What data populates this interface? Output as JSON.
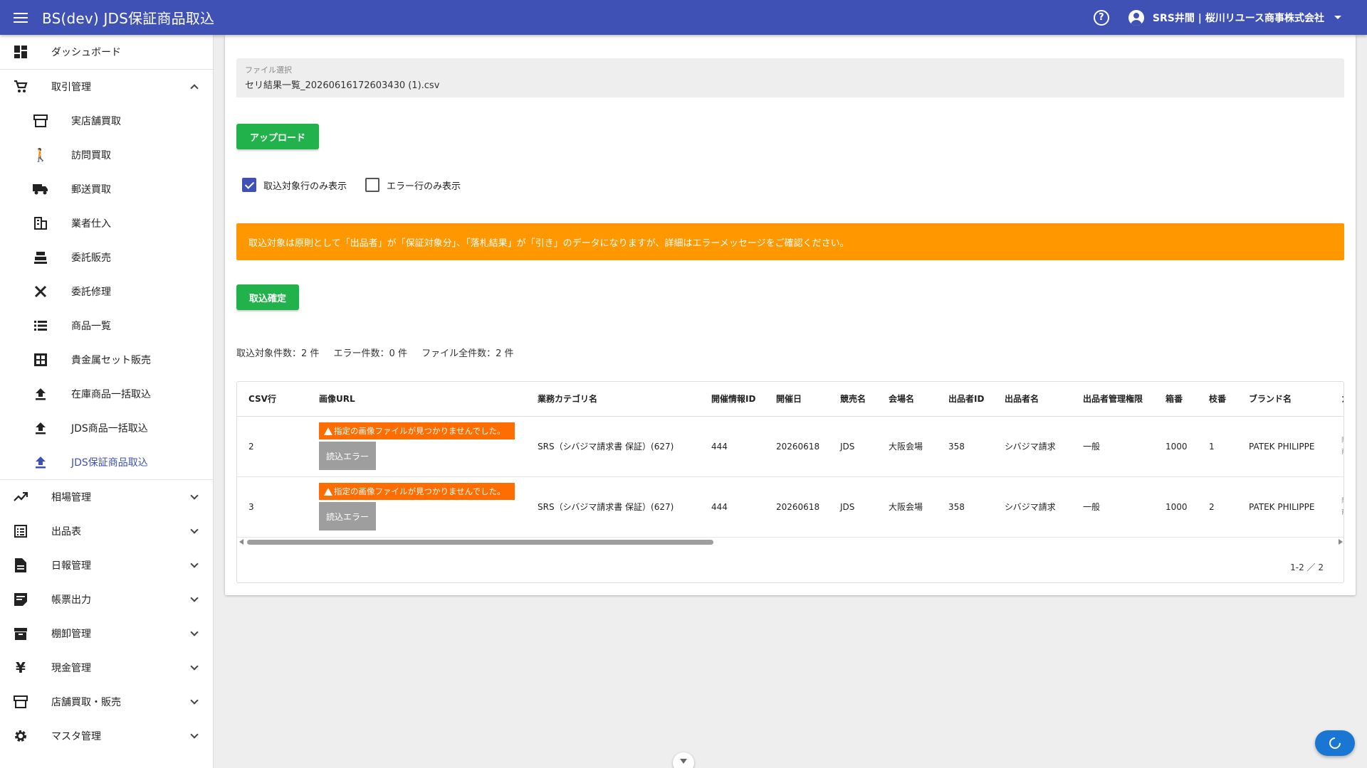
{
  "appbar": {
    "title": "BS(dev) JDS保証商品取込",
    "user": "SRS井間 | 桜川リユース商事株式会社"
  },
  "sidebar": {
    "items": [
      {
        "label": "ダッシュボード"
      },
      {
        "label": "取引管理"
      },
      {
        "label": "実店舗買取"
      },
      {
        "label": "訪問買取"
      },
      {
        "label": "郵送買取"
      },
      {
        "label": "業者仕入"
      },
      {
        "label": "委託販売"
      },
      {
        "label": "委託修理"
      },
      {
        "label": "商品一覧"
      },
      {
        "label": "貴金属セット販売"
      },
      {
        "label": "在庫商品一括取込"
      },
      {
        "label": "JDS商品一括取込"
      },
      {
        "label": "JDS保証商品取込"
      },
      {
        "label": "相場管理"
      },
      {
        "label": "出品表"
      },
      {
        "label": "日報管理"
      },
      {
        "label": "帳票出力"
      },
      {
        "label": "棚卸管理"
      },
      {
        "label": "現金管理"
      },
      {
        "label": "店舗買取・販売"
      },
      {
        "label": "マスタ管理"
      }
    ]
  },
  "main": {
    "file_label": "ファイル選択",
    "file_value": "セリ結果一覧_20260616172603430 (1).csv",
    "upload_label": "アップロード",
    "check_target_label": "取込対象行のみ表示",
    "check_error_label": "エラー行のみ表示",
    "alert": "取込対象は原則として「出品者」が「保証対象分」、「落札結果」が「引き」のデータになりますが、詳細はエラーメッセージをご確認ください。",
    "confirm_label": "取込確定",
    "count_target": "取込対象件数：2 件",
    "count_error": "エラー件数：0 件",
    "count_total": "ファイル全件数：2 件",
    "pager": "1-2 ／ 2"
  },
  "table": {
    "headers": [
      "CSV行",
      "画像URL",
      "業務カテゴリ名",
      "開催情報ID",
      "開催日",
      "競売名",
      "会場名",
      "出品者ID",
      "出品者名",
      "出品者管理権限",
      "箱番",
      "枝番",
      "ブランド名",
      "カ"
    ],
    "rows": [
      {
        "csv": "2",
        "err_msg": "指定の画像ファイルが見つかりませんでした。",
        "err_btn": "読込エラー",
        "category": "SRS（シバジマ請求書 保証）(627)",
        "event_id": "444",
        "date": "20260618",
        "auction": "JDS",
        "venue": "大阪会場",
        "seller_id": "358",
        "seller": "シバジマ請求",
        "perm": "一般",
        "box": "1000",
        "branch": "1",
        "brand": "PATEK PHILIPPE",
        "cut1": "限",
        "cut2": "商"
      },
      {
        "csv": "3",
        "err_msg": "指定の画像ファイルが見つかりませんでした。",
        "err_btn": "読込エラー",
        "category": "SRS（シバジマ請求書 保証）(627)",
        "event_id": "444",
        "date": "20260618",
        "auction": "JDS",
        "venue": "大阪会場",
        "seller_id": "358",
        "seller": "シバジマ請求",
        "perm": "一般",
        "box": "1000",
        "branch": "2",
        "brand": "PATEK PHILIPPE",
        "cut1": "限",
        "cut2": "商"
      }
    ]
  },
  "colors": {
    "appbar": "#3f51b5",
    "primary_button": "#21b24b",
    "alert": "#ff9800",
    "error_chip": "#ff6d00"
  }
}
